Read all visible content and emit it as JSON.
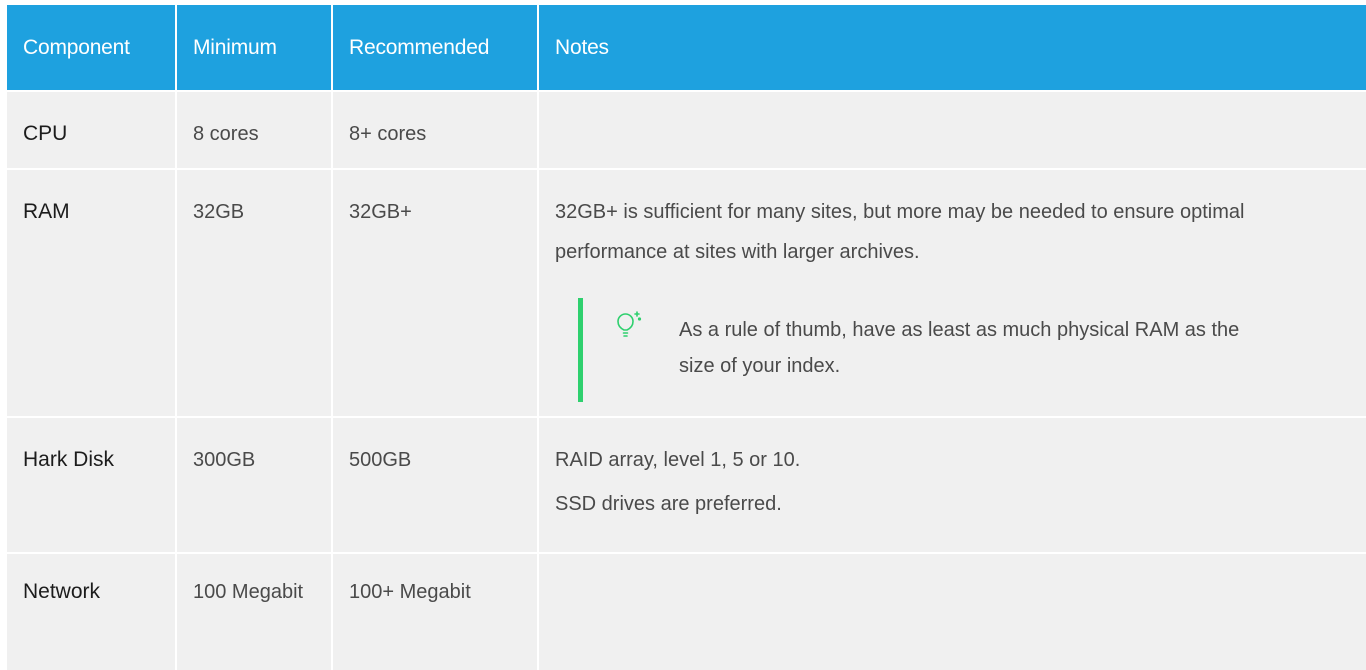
{
  "table": {
    "headers": [
      "Component",
      "Minimum",
      "Recommended",
      "Notes"
    ],
    "rows": {
      "cpu": {
        "component": "CPU",
        "minimum": "8 cores",
        "recommended": "8+ cores",
        "notes": ""
      },
      "ram": {
        "component": "RAM",
        "minimum": "32GB",
        "recommended": "32GB+",
        "notes": "32GB+ is sufficient for many sites, but more may be needed to ensure optimal performance at sites with larger archives.",
        "tip": {
          "icon": "lightbulb-icon",
          "text": "As a rule of thumb, have as least as much physical RAM as the size of your index."
        }
      },
      "disk": {
        "component": "Hark Disk",
        "minimum": "300GB",
        "recommended": "500GB",
        "notes_1": "RAID array, level 1, 5 or 10.",
        "notes_2": "SSD drives are preferred."
      },
      "network": {
        "component": "Network",
        "minimum": "100 Megabit",
        "recommended": "100+ Megabit",
        "notes": ""
      }
    }
  },
  "colors": {
    "header_bg": "#1ea1df",
    "cell_bg": "#f0f0f0",
    "tip_accent": "#2ed06e"
  }
}
